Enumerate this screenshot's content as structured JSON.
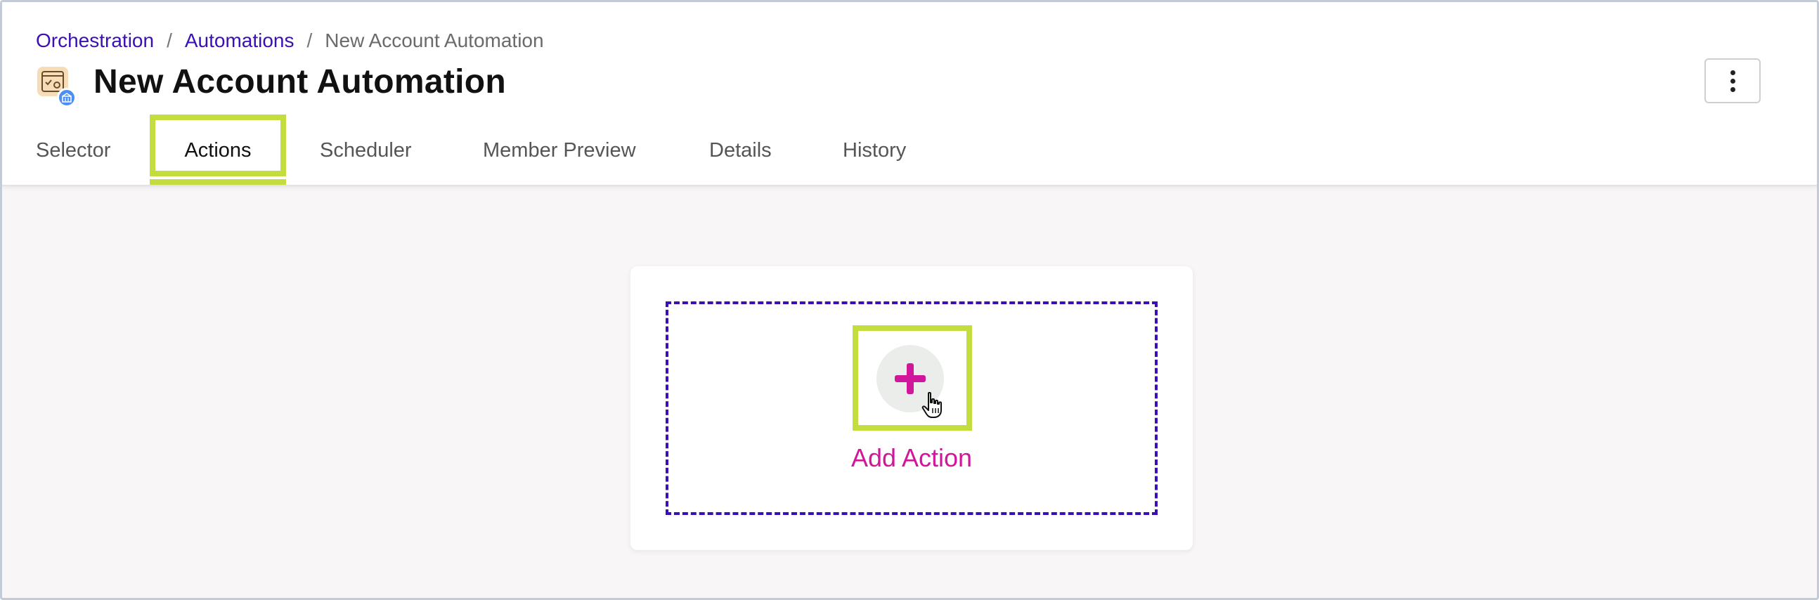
{
  "breadcrumb": {
    "items": [
      "Orchestration",
      "Automations"
    ],
    "separator": "/",
    "current": "New Account Automation"
  },
  "header": {
    "title": "New Account Automation",
    "app_icon": "automation-icon",
    "menu_icon": "kebab-menu-icon"
  },
  "tabs": [
    {
      "label": "Selector"
    },
    {
      "label": "Actions",
      "active": true
    },
    {
      "label": "Scheduler"
    },
    {
      "label": "Member Preview"
    },
    {
      "label": "Details"
    },
    {
      "label": "History"
    }
  ],
  "main": {
    "add_action_label": "Add Action",
    "add_icon": "plus-icon"
  },
  "colors": {
    "link": "#3b0fb5",
    "accent": "#d0169b",
    "highlight": "#c3dc3e",
    "dropzone_border": "#3a0fb5"
  }
}
